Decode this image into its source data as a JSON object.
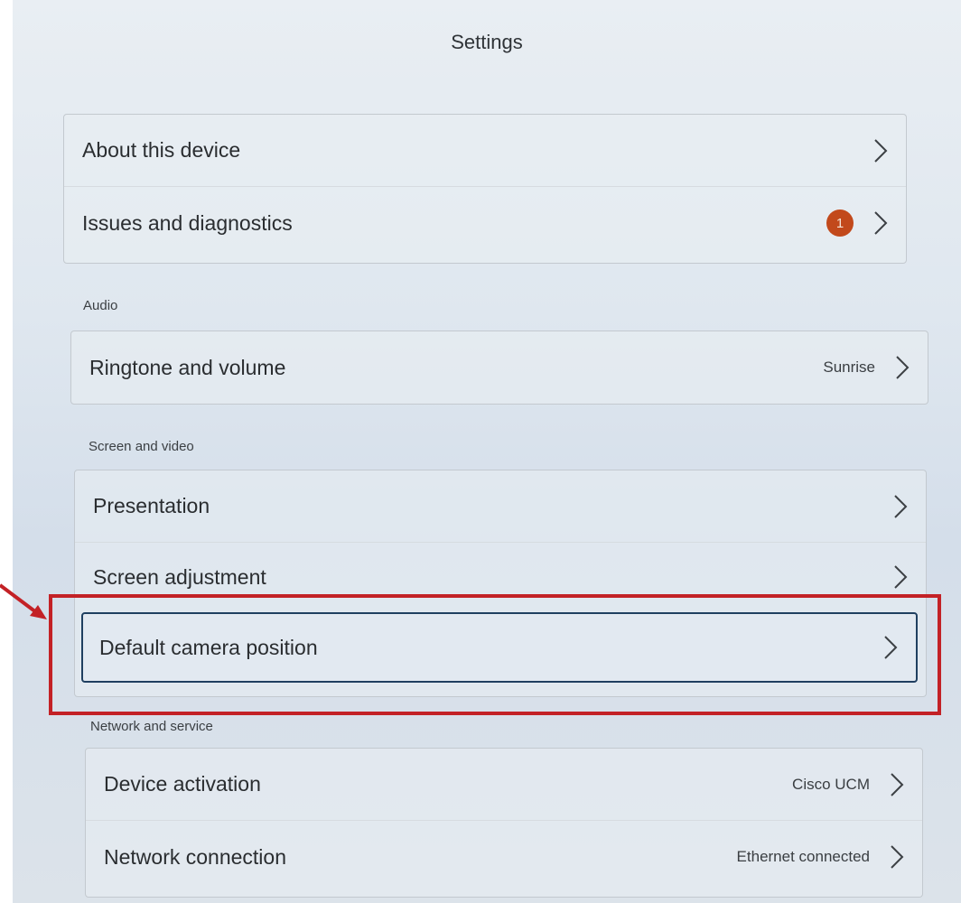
{
  "header": {
    "title": "Settings"
  },
  "groups": {
    "general": [
      {
        "label": "About this device"
      },
      {
        "label": "Issues and diagnostics",
        "badge": "1"
      }
    ],
    "audio": {
      "heading": "Audio",
      "items": [
        {
          "label": "Ringtone and volume",
          "value": "Sunrise"
        }
      ]
    },
    "screen_video": {
      "heading": "Screen and video",
      "items": [
        {
          "label": "Presentation"
        },
        {
          "label": "Screen adjustment"
        },
        {
          "label": "Default camera position",
          "focused": true
        }
      ]
    },
    "network": {
      "heading": "Network and service",
      "items": [
        {
          "label": "Device activation",
          "value": "Cisco UCM"
        },
        {
          "label": "Network connection",
          "value": "Ethernet connected"
        }
      ]
    }
  },
  "annotation": {
    "highlight_color": "#c32126",
    "badge_color": "#c2491b"
  },
  "icons": {
    "chevron": "chevron-right-icon"
  }
}
